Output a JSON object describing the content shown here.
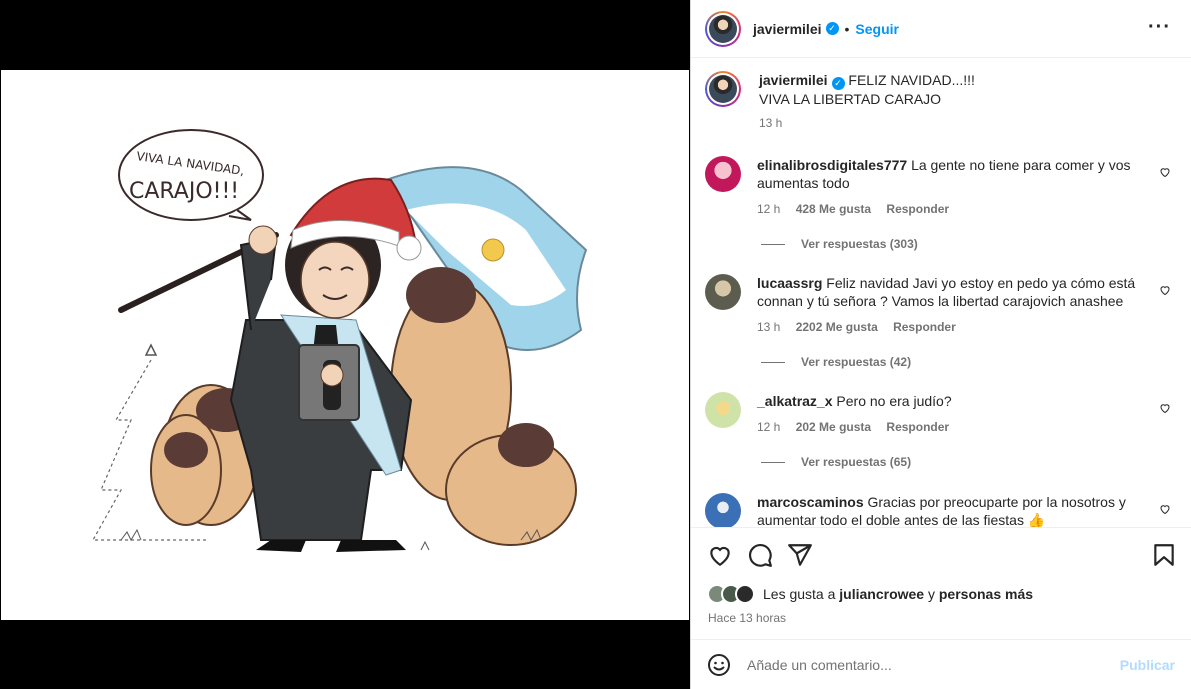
{
  "post": {
    "username": "javiermilei",
    "follow_label": "Seguir",
    "caption_line1": "FELIZ NAVIDAD...!!!",
    "caption_line2": "VIVA LA LIBERTAD CARAJO",
    "caption_time": "13 h"
  },
  "illustration": {
    "speech_line1": "VIVA LA NAVIDAD,",
    "speech_line2": "CARAJO!!!"
  },
  "comments": [
    {
      "user": "elinalibrosdigitales777",
      "text": "La gente no tiene para comer y vos aumentas todo",
      "time": "12 h",
      "likes": "428 Me gusta",
      "reply_label": "Responder",
      "view_replies": "Ver respuestas (303)",
      "avatar_color": "#c2185b"
    },
    {
      "user": "lucaassrg",
      "text": "Feliz navidad Javi yo estoy en pedo ya cómo está connan y tú señora ? Vamos la libertad carajovich anashee",
      "time": "13 h",
      "likes": "2202 Me gusta",
      "reply_label": "Responder",
      "view_replies": "Ver respuestas (42)",
      "avatar_color": "#5d5d4f"
    },
    {
      "user": "_alkatraz_x",
      "text": "Pero no era judío?",
      "time": "12 h",
      "likes": "202 Me gusta",
      "reply_label": "Responder",
      "view_replies": "Ver respuestas (65)",
      "avatar_color": "#cfe3a8"
    },
    {
      "user": "marcoscaminos",
      "text": "Gracias por preocuparte por la nosotros y aumentar todo el doble antes de las fiestas 👍",
      "avatar_color": "#3b6fb6"
    }
  ],
  "actions": {
    "icons": [
      "heart-icon",
      "comment-icon",
      "share-icon",
      "bookmark-icon"
    ],
    "likes_prefix": "Les gusta a",
    "likes_user": "juliancrowee",
    "likes_connector": "y",
    "likes_suffix": "personas más",
    "time_ago": "Hace 13 horas"
  },
  "add_comment": {
    "placeholder": "Añade un comentario...",
    "publish_label": "Publicar"
  },
  "colors": {
    "accent": "#0095f6",
    "publish_disabled": "#b3dbff",
    "muted": "#737373"
  }
}
